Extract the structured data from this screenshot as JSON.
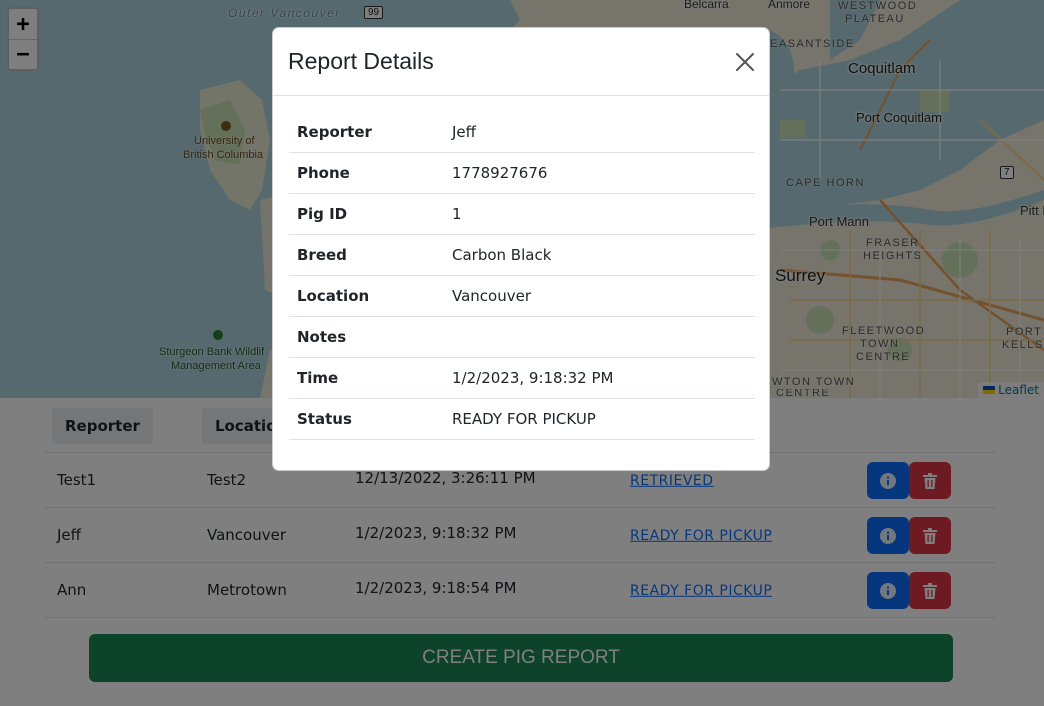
{
  "map": {
    "zoom_in": "+",
    "zoom_out": "−",
    "attribution": "Leaflet",
    "labels": {
      "outer_vancouver": "Outer Vancouver",
      "hwy99": "99",
      "belcarra": "Belcarra",
      "anmore": "Anmore",
      "westwood_1": "WESTWOOD",
      "westwood_2": "PLATEAU",
      "eastside": "EASANTSIDE",
      "coquitlam": "Coquitlam",
      "port_coquitlam": "Port Coquitlam",
      "hwy7": "7",
      "cape_horn": "CAPE HORN",
      "port_mann": "Port Mann",
      "fraser_1": "FRASER",
      "fraser_2": "HEIGHTS",
      "pitt_meadows": "Pitt Mea",
      "surrey": "Surrey",
      "fleetwood_1": "FLEETWOOD",
      "fleetwood_2": "TOWN",
      "fleetwood_3": "CENTRE",
      "port_kells_1": "PORT",
      "port_kells_2": "KELLS",
      "ubc_1": "University of",
      "ubc_2": "British Columbia",
      "sturgeon_1": "Sturgeon Bank Wildlif",
      "sturgeon_2": "Management Area",
      "newton_1": "WTON TOWN",
      "newton_2": "CENTRE"
    }
  },
  "table": {
    "headers": [
      "Reporter",
      "Location"
    ],
    "rows": [
      {
        "reporter": "Test1",
        "location": "Test2",
        "time": "12/13/2022, 3:26:11 PM",
        "status": "RETRIEVED"
      },
      {
        "reporter": "Jeff",
        "location": "Vancouver",
        "time": "1/2/2023, 9:18:32 PM",
        "status": "READY FOR PICKUP"
      },
      {
        "reporter": "Ann",
        "location": "Metrotown",
        "time": "1/2/2023, 9:18:54 PM",
        "status": "READY FOR PICKUP"
      }
    ],
    "create_label": "CREATE PIG REPORT"
  },
  "modal": {
    "title": "Report Details",
    "rows": [
      {
        "label": "Reporter",
        "value": "Jeff"
      },
      {
        "label": "Phone",
        "value": "1778927676"
      },
      {
        "label": "Pig ID",
        "value": "1"
      },
      {
        "label": "Breed",
        "value": "Carbon Black"
      },
      {
        "label": "Location",
        "value": "Vancouver"
      },
      {
        "label": "Notes",
        "value": ""
      },
      {
        "label": "Time",
        "value": "1/2/2023, 9:18:32 PM"
      },
      {
        "label": "Status",
        "value": "READY FOR PICKUP"
      }
    ]
  },
  "colors": {
    "primary": "#0d6efd",
    "danger": "#dc3545",
    "success": "#198754",
    "water": "#aad3df"
  }
}
